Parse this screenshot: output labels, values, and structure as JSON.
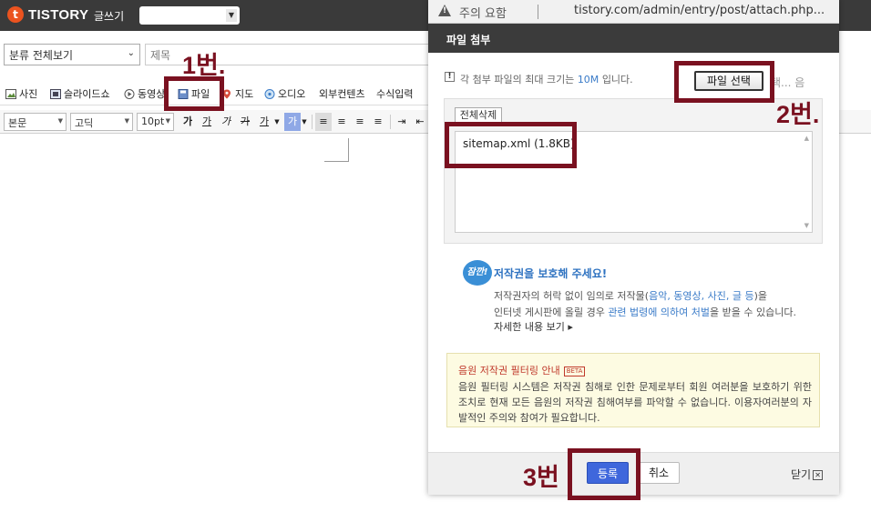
{
  "header": {
    "logo_text": "TISTORY",
    "write_label": "글쓰기"
  },
  "editor": {
    "category": "분류 전체보기",
    "title_placeholder": "제목",
    "attach_items": [
      "사진",
      "슬라이드쇼",
      "동영상",
      "파일",
      "지도",
      "오디오",
      "외부컨텐츠",
      "수식입력"
    ],
    "format": {
      "style": "본문",
      "font": "고딕",
      "size": "10pt",
      "text_buttons": [
        "가",
        "가",
        "가",
        "가",
        "가",
        "가"
      ]
    }
  },
  "popup": {
    "url_warning": "주의 요함",
    "url": "tistory.com/admin/entry/post/attach.php...",
    "title": "파일 첨부",
    "info_prefix": "각 첨부 파일의 최대 크기는",
    "info_size": "10M",
    "info_suffix": "입니다.",
    "file_select": "파일 선택",
    "file_none": "택... 음",
    "delete_all": "전체삭제",
    "files": [
      "sitemap.xml (1.8KB)"
    ],
    "badge": "잠깐!",
    "copyright_title": "저작권을 보호해 주세요!",
    "copyright_line1_a": "저작권자의 허락 없이 임의로 저작물(",
    "copyright_line1_hl": "음악, 동영상, 사진, 글 등",
    "copyright_line1_b": ")을",
    "copyright_line2_a": "인터넷 게시판에 올릴 경우",
    "copyright_line2_hl": "관련 법령에 의하여 처벌",
    "copyright_line2_b": "을 받을 수 있습니다.",
    "detail_link": "자세한 내용 보기 ▸",
    "music_title": "음원 저작권 필터링 안내",
    "music_beta": "BETA",
    "music_body": "음원 필터링 시스템은 저작권 침해로 인한 문제로부터 회원 여러분을 보호하기 위한 조치로 현재 모든 음원의 저작권 침해여부를 파악할 수 없습니다. 이용자여러분의 자발적인 주의와 참여가 필요합니다.",
    "register": "등록",
    "cancel": "취소",
    "close": "닫기"
  },
  "annotations": {
    "step1": "1번.",
    "step2": "2번.",
    "step3": "3번"
  },
  "colors": {
    "annotation": "#7a1120",
    "register_button": "#3f67dc",
    "popup_header": "#3b3b3b",
    "logo_mark": "#eb531f"
  }
}
